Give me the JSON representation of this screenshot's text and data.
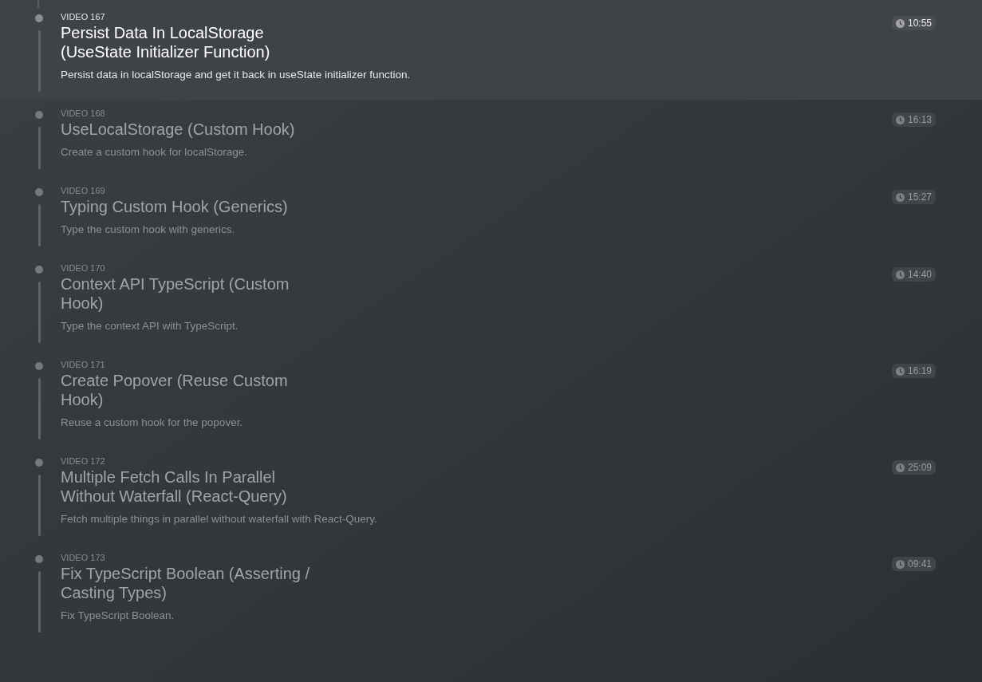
{
  "videos": [
    {
      "label": "VIDEO 167",
      "title": "Persist Data In LocalStorage (UseState Initializer Function)",
      "description": "Persist data in localStorage and get it back in useState initializer function.",
      "duration": "10:55",
      "selected": true
    },
    {
      "label": "VIDEO 168",
      "title": "UseLocalStorage (Custom Hook)",
      "description": "Create a custom hook for localStorage.",
      "duration": "16:13",
      "selected": false
    },
    {
      "label": "VIDEO 169",
      "title": "Typing Custom Hook (Generics)",
      "description": "Type the custom hook with generics.",
      "duration": "15:27",
      "selected": false
    },
    {
      "label": "VIDEO 170",
      "title": "Context API TypeScript (Custom Hook)",
      "description": "Type the context API with TypeScript.",
      "duration": "14:40",
      "selected": false
    },
    {
      "label": "VIDEO 171",
      "title": "Create Popover (Reuse Custom Hook)",
      "description": "Reuse a custom hook for the popover.",
      "duration": "16:19",
      "selected": false
    },
    {
      "label": "VIDEO 172",
      "title": "Multiple Fetch Calls In Parallel Without Waterfall (React-Query)",
      "description": "Fetch multiple things in parallel without waterfall with React-Query.",
      "duration": "25:09",
      "selected": false
    },
    {
      "label": "VIDEO 173",
      "title": "Fix TypeScript Boolean (Asserting / Casting Types)",
      "description": "Fix TypeScript Boolean.",
      "duration": "09:41",
      "selected": false
    }
  ]
}
